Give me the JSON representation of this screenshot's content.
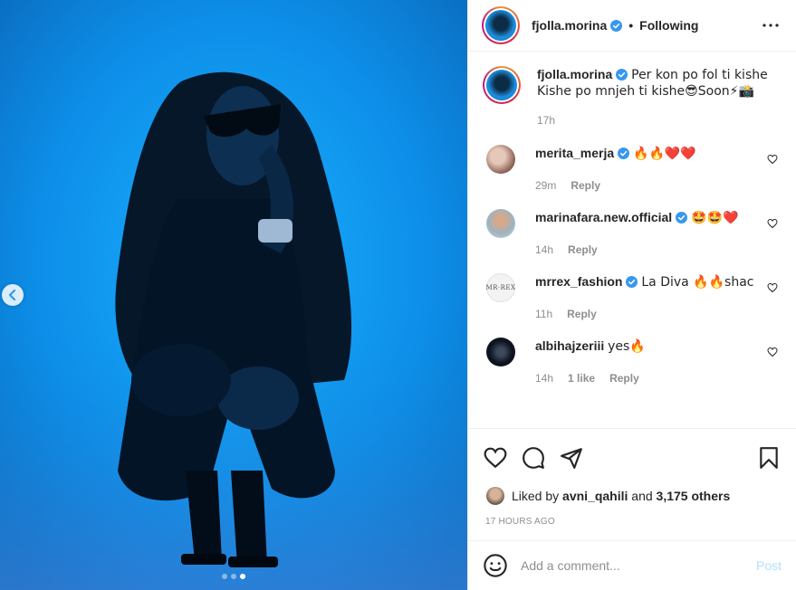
{
  "post": {
    "author": "fjolla.morina",
    "follow_separator": "•",
    "follow_status": "Following",
    "caption_line1": "Per kon po fol ti kishe",
    "caption_line2": "Kishe po mnjeh ti kishe😎Soon⚡📸",
    "caption_time": "17h",
    "slide_count": 3,
    "active_slide": 3
  },
  "comments": [
    {
      "user": "merita_merja",
      "verified": true,
      "text": "🔥🔥❤️❤️",
      "time": "29m",
      "likes": "",
      "reply": "Reply",
      "avatar_color": "#c9a394"
    },
    {
      "user": "marinafara.new.official",
      "verified": true,
      "text": "🤩🤩❤️",
      "time": "14h",
      "likes": "",
      "reply": "Reply",
      "avatar_color": "#a8bfc9"
    },
    {
      "user": "mrrex_fashion",
      "verified": true,
      "text": "La Diva 🔥🔥shac",
      "time": "11h",
      "likes": "",
      "reply": "Reply",
      "avatar_color": "#f4f4f4"
    },
    {
      "user": "albihajzeriii",
      "verified": false,
      "text": "yes🔥",
      "time": "14h",
      "likes": "1 like",
      "reply": "Reply",
      "avatar_color": "#0e1320"
    }
  ],
  "likes": {
    "prefix": "Liked by",
    "user": "avni_qahili",
    "joiner": "and",
    "others": "3,175 others"
  },
  "timestamp": "17 HOURS AGO",
  "composer": {
    "placeholder": "Add a comment...",
    "post_label": "Post"
  },
  "icons": {
    "verified": "verified-badge-icon",
    "more": "more-horizontal-icon",
    "like": "heart-icon",
    "comment": "comment-bubble-icon",
    "share": "paper-plane-icon",
    "save": "bookmark-icon",
    "emoji": "smiley-icon",
    "prev": "chevron-left-icon"
  },
  "colors": {
    "verified_blue": "#3897f0",
    "post_disabled": "#b2dffc",
    "muted_text": "#8e8e8e",
    "photo_blue": "#0e8fe8"
  }
}
